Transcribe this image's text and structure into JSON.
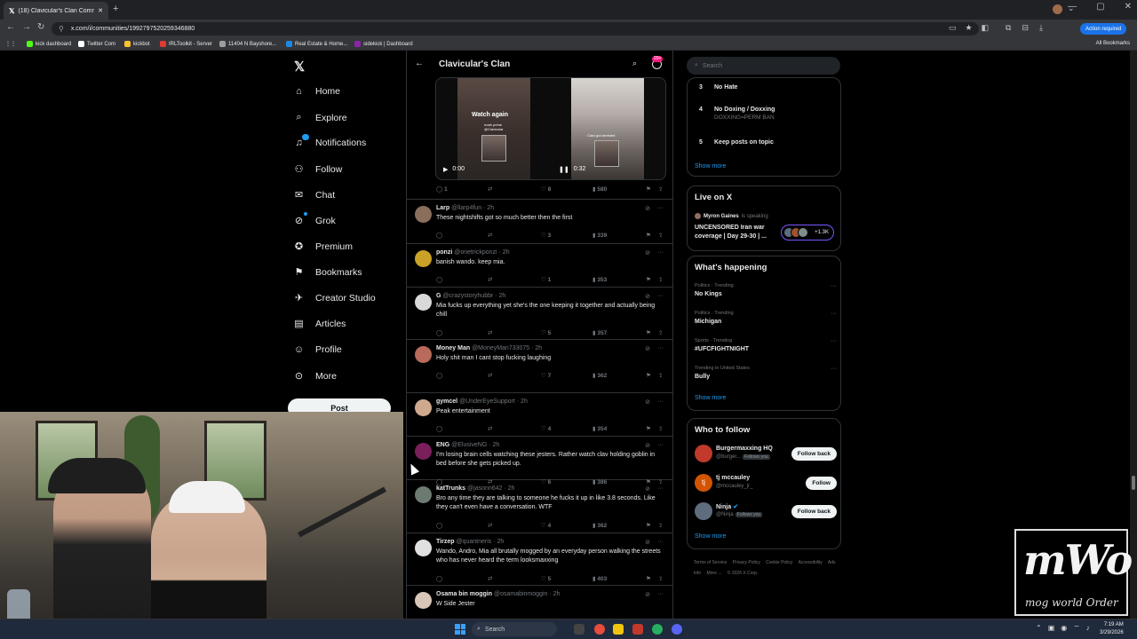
{
  "browser": {
    "tab_title": "(18) Clavicular's Clan Communi",
    "url": "x.com/i/communities/1992797520259346880",
    "action_button": "Action required",
    "bookmarks": [
      "kick dashboard",
      "Twitter Com",
      "kickbot",
      "IRLToolkit - Server",
      "11404 N Bayshore...",
      "Real Estate & Home...",
      "sidekick | Dashboard"
    ],
    "all_bookmarks": "All Bookmarks"
  },
  "nav": {
    "items": [
      "Home",
      "Explore",
      "Notifications",
      "Follow",
      "Chat",
      "Grok",
      "Premium",
      "Bookmarks",
      "Creator Studio",
      "Articles",
      "Profile",
      "More"
    ],
    "icons": [
      "home-icon",
      "explore-icon",
      "notifications-icon",
      "follow-icon",
      "chat-icon",
      "grok-icon",
      "premium-icon",
      "bookmarks-icon",
      "creator-studio-icon",
      "articles-icon",
      "profile-icon",
      "more-icon"
    ],
    "post_label": "Post"
  },
  "community": {
    "title": "Clavicular's Clan",
    "badge": "20+"
  },
  "media": {
    "watch_again": "Watch again",
    "caption1": "noah prime\n@Clavicular",
    "caption2": "Clavi got arrested",
    "time1": "0:00",
    "time2": "0:32",
    "stats": {
      "replies": "1",
      "likes": "8",
      "views": "580"
    }
  },
  "tweets": [
    {
      "name": "Larp",
      "handle": "@llarp4fun · 2h",
      "text": "These nightshifts got so much better then the first",
      "replies": "",
      "likes": "3",
      "views": "339",
      "avatar": "#8a6f5c"
    },
    {
      "name": "ponzi",
      "handle": "@onetrickponzi · 2h",
      "text": "banish wando. keep mia.",
      "replies": "",
      "likes": "1",
      "views": "353",
      "avatar": "#c9a227"
    },
    {
      "name": "G",
      "handle": "@crazystoryhubbr · 2h",
      "text": "Mia fucks up everything yet she's the one keeping it together and actually being chill",
      "replies": "",
      "likes": "5",
      "views": "357",
      "avatar": "#d9d9d9"
    },
    {
      "name": "Money Man",
      "handle": "@MoneyMan733075 · 2h",
      "text": "Holy shit man I cant stop fucking laughing",
      "replies": "",
      "likes": "7",
      "views": "362",
      "avatar": "#b96a5a"
    },
    {
      "name": "gymcel",
      "handle": "@UnderEyeSupport · 2h",
      "text": "Peak entertainment",
      "replies": "",
      "likes": "4",
      "views": "354",
      "avatar": "#cfa98e"
    },
    {
      "name": "ENG",
      "handle": "@ElusiveNG · 2h",
      "text": "I'm losing brain cells watching these jesters. Rather watch clav holding goblin in bed before she gets picked up.",
      "replies": "",
      "likes": "6",
      "views": "386",
      "avatar": "#7a1f5a"
    },
    {
      "name": "katTrunks",
      "handle": "@jasonn642 · 2h",
      "text": "Bro any time they are talking to someone he fucks it up in like 3.8 seconds. Like they can't even have a conversation. WTF",
      "replies": "",
      "likes": "4",
      "views": "362",
      "avatar": "#6c7a72"
    },
    {
      "name": "Tirzep",
      "handle": "@quantneris · 2h",
      "text": "Wando, Andro, Mia all brutally mogged by an everyday person walking the streets who has never heard the term looksmaxxing",
      "replies": "",
      "likes": "5",
      "views": "403",
      "avatar": "#e0e0e0"
    },
    {
      "name": "Osama bin moggin",
      "handle": "@osamabinmoggin · 2h",
      "text": "W Side Jester",
      "replies": "",
      "likes": "",
      "views": "",
      "avatar": "#d8c7b8"
    }
  ],
  "right": {
    "search_placeholder": "Search",
    "rules": [
      {
        "n": "3",
        "title": "No Hate",
        "sub": ""
      },
      {
        "n": "4",
        "title": "No Doxing / Doxxing",
        "sub": "DOXXING=PERM BAN"
      },
      {
        "n": "5",
        "title": "Keep posts on topic",
        "sub": ""
      }
    ],
    "show_more": "Show more",
    "live": {
      "title": "Live on X",
      "host": "Myron Gaines",
      "host_suffix": "is speaking",
      "stream_title": "UNCENSORED Iran war coverage | Day 29-30 | ...",
      "count": "+1.3K"
    },
    "happening": {
      "title": "What's happening",
      "trends": [
        {
          "cat": "Politics · Trending",
          "name": "No Kings"
        },
        {
          "cat": "Politics · Trending",
          "name": "Michigan"
        },
        {
          "cat": "Sports · Trending",
          "name": "#UFCFIGHTNIGHT"
        },
        {
          "cat": "Trending in United States",
          "name": "Bully"
        }
      ]
    },
    "who_to_follow": {
      "title": "Who to follow",
      "users": [
        {
          "name": "Burgermaxxing HQ",
          "handle": "@burger...",
          "follows_you": "Follows you",
          "button": "Follow back",
          "avatar": "#c0392b"
        },
        {
          "name": "tj mccauley",
          "handle": "@mccauley_jr_",
          "follows_you": "",
          "button": "Follow",
          "avatar": "#d35400"
        },
        {
          "name": "Ninja",
          "handle": "@Ninja",
          "follows_you": "Follows you",
          "button": "Follow back",
          "avatar": "#5d6d7e"
        }
      ]
    },
    "footer": [
      "Terms of Service",
      "Privacy Policy",
      "Cookie Policy",
      "Accessibility",
      "Ads info",
      "More ...",
      "© 2026 X Corp."
    ]
  },
  "overlay": {
    "logo_big": "mWo",
    "logo_small": "mog world Order"
  },
  "taskbar": {
    "search": "Search",
    "time": "7:19 AM",
    "date": "3/29/2026"
  }
}
